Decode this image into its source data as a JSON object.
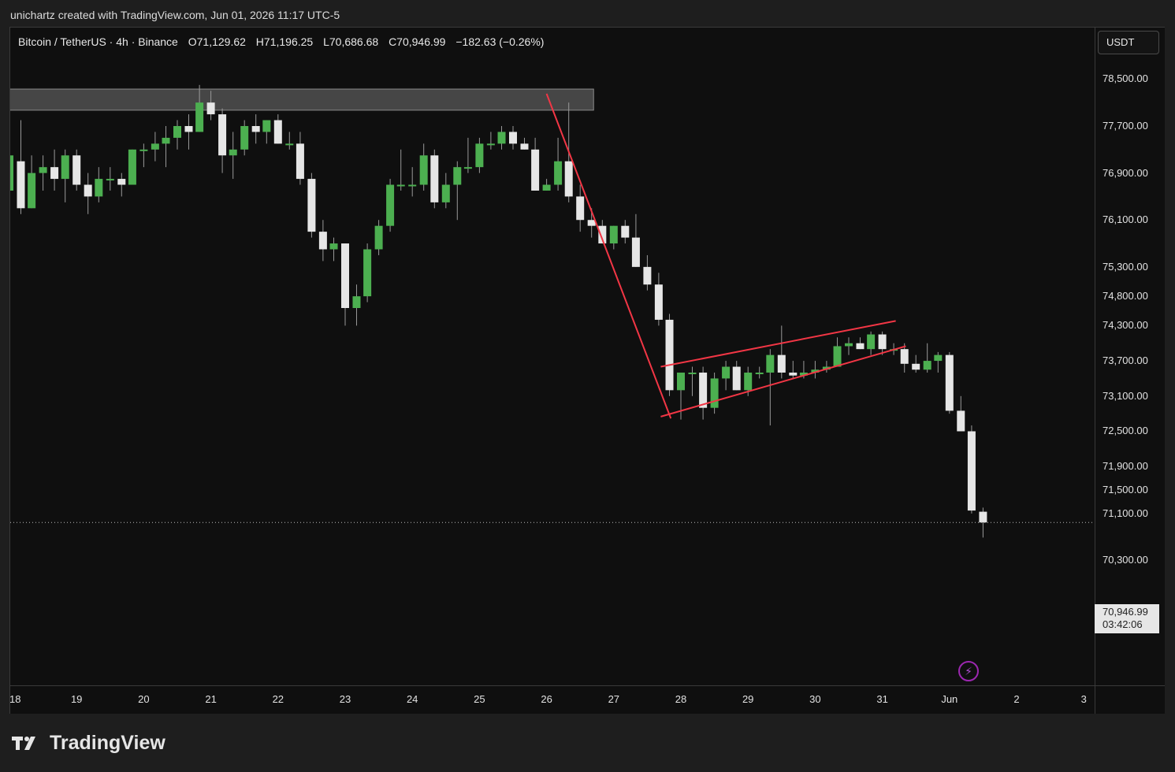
{
  "header": {
    "caption": "unichartz created with TradingView.com, Jun 01, 2026 11:17 UTC-5"
  },
  "legend": {
    "symbol": "Bitcoin / TetherUS · 4h · Binance",
    "open": "O71,129.62",
    "high": "H71,196.25",
    "low": "L70,686.68",
    "close": "C70,946.99",
    "change": "−182.63 (−0.26%)"
  },
  "currency_button": "USDT",
  "last_price": {
    "value": "70,946.99",
    "countdown": "03:42:06"
  },
  "brand": {
    "name": "TradingView"
  },
  "colors": {
    "bull": "#4caf50",
    "bear": "#e6e6e6",
    "background": "#0f0f0f",
    "annotation": "#f23645",
    "zone": "#5a5a5a"
  },
  "chart_data": {
    "type": "candlestick",
    "timeframe": "4h",
    "y_tick_labels": [
      "78,500.00",
      "77,700.00",
      "76,900.00",
      "76,100.00",
      "75,300.00",
      "74,800.00",
      "74,300.00",
      "73,700.00",
      "73,100.00",
      "72,500.00",
      "71,900.00",
      "71,500.00",
      "71,100.00",
      "70,300.00"
    ],
    "x_tick_labels": [
      "18",
      "19",
      "20",
      "21",
      "22",
      "23",
      "24",
      "25",
      "26",
      "27",
      "28",
      "29",
      "30",
      "31",
      "Jun",
      "2",
      "3"
    ],
    "y_range": [
      70000,
      78900
    ],
    "x_range_days": [
      18,
      34
    ],
    "candles": [
      {
        "t": 18.0,
        "o": 76600,
        "h": 77500,
        "l": 76100,
        "c": 77200
      },
      {
        "t": 18.17,
        "o": 77100,
        "h": 77800,
        "l": 76200,
        "c": 76300
      },
      {
        "t": 18.33,
        "o": 76300,
        "h": 77200,
        "l": 76300,
        "c": 76900
      },
      {
        "t": 18.5,
        "o": 76900,
        "h": 77200,
        "l": 76600,
        "c": 77000
      },
      {
        "t": 18.67,
        "o": 77000,
        "h": 77300,
        "l": 76600,
        "c": 76800
      },
      {
        "t": 18.83,
        "o": 76800,
        "h": 77300,
        "l": 76400,
        "c": 77200
      },
      {
        "t": 19.0,
        "o": 77200,
        "h": 77300,
        "l": 76600,
        "c": 76700
      },
      {
        "t": 19.17,
        "o": 76700,
        "h": 76900,
        "l": 76200,
        "c": 76500
      },
      {
        "t": 19.33,
        "o": 76500,
        "h": 77000,
        "l": 76400,
        "c": 76800
      },
      {
        "t": 19.5,
        "o": 76800,
        "h": 77000,
        "l": 76600,
        "c": 76800
      },
      {
        "t": 19.67,
        "o": 76800,
        "h": 76900,
        "l": 76500,
        "c": 76700
      },
      {
        "t": 19.83,
        "o": 76700,
        "h": 77300,
        "l": 76700,
        "c": 77300
      },
      {
        "t": 20.0,
        "o": 77300,
        "h": 77400,
        "l": 77000,
        "c": 77300
      },
      {
        "t": 20.17,
        "o": 77300,
        "h": 77600,
        "l": 77100,
        "c": 77400
      },
      {
        "t": 20.33,
        "o": 77400,
        "h": 77700,
        "l": 77000,
        "c": 77500
      },
      {
        "t": 20.5,
        "o": 77500,
        "h": 77800,
        "l": 77300,
        "c": 77700
      },
      {
        "t": 20.67,
        "o": 77700,
        "h": 77900,
        "l": 77300,
        "c": 77600
      },
      {
        "t": 20.83,
        "o": 77600,
        "h": 78400,
        "l": 77600,
        "c": 78100
      },
      {
        "t": 21.0,
        "o": 78100,
        "h": 78300,
        "l": 77800,
        "c": 77900
      },
      {
        "t": 21.17,
        "o": 77900,
        "h": 78000,
        "l": 76900,
        "c": 77200
      },
      {
        "t": 21.33,
        "o": 77200,
        "h": 77600,
        "l": 76800,
        "c": 77300
      },
      {
        "t": 21.5,
        "o": 77300,
        "h": 77800,
        "l": 77200,
        "c": 77700
      },
      {
        "t": 21.67,
        "o": 77700,
        "h": 77900,
        "l": 77400,
        "c": 77600
      },
      {
        "t": 21.83,
        "o": 77600,
        "h": 77800,
        "l": 77400,
        "c": 77800
      },
      {
        "t": 22.0,
        "o": 77800,
        "h": 77900,
        "l": 77400,
        "c": 77400
      },
      {
        "t": 22.17,
        "o": 77400,
        "h": 77600,
        "l": 77300,
        "c": 77400
      },
      {
        "t": 22.33,
        "o": 77400,
        "h": 77600,
        "l": 76700,
        "c": 76800
      },
      {
        "t": 22.5,
        "o": 76800,
        "h": 76900,
        "l": 75800,
        "c": 75900
      },
      {
        "t": 22.67,
        "o": 75900,
        "h": 76100,
        "l": 75400,
        "c": 75600
      },
      {
        "t": 22.83,
        "o": 75600,
        "h": 75800,
        "l": 75400,
        "c": 75700
      },
      {
        "t": 23.0,
        "o": 75700,
        "h": 75700,
        "l": 74300,
        "c": 74600
      },
      {
        "t": 23.17,
        "o": 74600,
        "h": 75000,
        "l": 74300,
        "c": 74800
      },
      {
        "t": 23.33,
        "o": 74800,
        "h": 75700,
        "l": 74700,
        "c": 75600
      },
      {
        "t": 23.5,
        "o": 75600,
        "h": 76100,
        "l": 75500,
        "c": 76000
      },
      {
        "t": 23.67,
        "o": 76000,
        "h": 76800,
        "l": 75900,
        "c": 76700
      },
      {
        "t": 23.83,
        "o": 76700,
        "h": 77300,
        "l": 76600,
        "c": 76700
      },
      {
        "t": 24.0,
        "o": 76700,
        "h": 77000,
        "l": 76500,
        "c": 76700
      },
      {
        "t": 24.17,
        "o": 76700,
        "h": 77400,
        "l": 76600,
        "c": 77200
      },
      {
        "t": 24.33,
        "o": 77200,
        "h": 77300,
        "l": 76300,
        "c": 76400
      },
      {
        "t": 24.5,
        "o": 76400,
        "h": 76900,
        "l": 76300,
        "c": 76700
      },
      {
        "t": 24.67,
        "o": 76700,
        "h": 77100,
        "l": 76100,
        "c": 77000
      },
      {
        "t": 24.83,
        "o": 77000,
        "h": 77500,
        "l": 76900,
        "c": 77000
      },
      {
        "t": 25.0,
        "o": 77000,
        "h": 77500,
        "l": 76900,
        "c": 77400
      },
      {
        "t": 25.17,
        "o": 77400,
        "h": 77600,
        "l": 77300,
        "c": 77400
      },
      {
        "t": 25.33,
        "o": 77400,
        "h": 77700,
        "l": 77300,
        "c": 77600
      },
      {
        "t": 25.5,
        "o": 77600,
        "h": 77700,
        "l": 77300,
        "c": 77400
      },
      {
        "t": 25.67,
        "o": 77400,
        "h": 77500,
        "l": 77300,
        "c": 77300
      },
      {
        "t": 25.83,
        "o": 77300,
        "h": 77500,
        "l": 76600,
        "c": 76600
      },
      {
        "t": 26.0,
        "o": 76600,
        "h": 76800,
        "l": 76600,
        "c": 76700
      },
      {
        "t": 26.17,
        "o": 76700,
        "h": 77500,
        "l": 76600,
        "c": 77100
      },
      {
        "t": 26.33,
        "o": 77100,
        "h": 78100,
        "l": 76400,
        "c": 76500
      },
      {
        "t": 26.5,
        "o": 76500,
        "h": 76700,
        "l": 75900,
        "c": 76100
      },
      {
        "t": 26.67,
        "o": 76100,
        "h": 76300,
        "l": 75800,
        "c": 76000
      },
      {
        "t": 26.83,
        "o": 76000,
        "h": 76100,
        "l": 75700,
        "c": 75700
      },
      {
        "t": 27.0,
        "o": 75700,
        "h": 76000,
        "l": 75600,
        "c": 76000
      },
      {
        "t": 27.17,
        "o": 76000,
        "h": 76100,
        "l": 75700,
        "c": 75800
      },
      {
        "t": 27.33,
        "o": 75800,
        "h": 76200,
        "l": 75300,
        "c": 75300
      },
      {
        "t": 27.5,
        "o": 75300,
        "h": 75500,
        "l": 74900,
        "c": 75000
      },
      {
        "t": 27.67,
        "o": 75000,
        "h": 75200,
        "l": 74300,
        "c": 74400
      },
      {
        "t": 27.83,
        "o": 74400,
        "h": 74500,
        "l": 73100,
        "c": 73200
      },
      {
        "t": 28.0,
        "o": 73200,
        "h": 73500,
        "l": 72700,
        "c": 73500
      },
      {
        "t": 28.17,
        "o": 73500,
        "h": 73600,
        "l": 73100,
        "c": 73500
      },
      {
        "t": 28.33,
        "o": 73500,
        "h": 73600,
        "l": 72700,
        "c": 72900
      },
      {
        "t": 28.5,
        "o": 72900,
        "h": 73500,
        "l": 72800,
        "c": 73400
      },
      {
        "t": 28.67,
        "o": 73400,
        "h": 73700,
        "l": 73200,
        "c": 73600
      },
      {
        "t": 28.83,
        "o": 73600,
        "h": 73700,
        "l": 73200,
        "c": 73200
      },
      {
        "t": 29.0,
        "o": 73200,
        "h": 73600,
        "l": 73100,
        "c": 73500
      },
      {
        "t": 29.17,
        "o": 73500,
        "h": 73600,
        "l": 73400,
        "c": 73500
      },
      {
        "t": 29.33,
        "o": 73500,
        "h": 73900,
        "l": 72600,
        "c": 73800
      },
      {
        "t": 29.5,
        "o": 73800,
        "h": 74300,
        "l": 73400,
        "c": 73500
      },
      {
        "t": 29.67,
        "o": 73500,
        "h": 73700,
        "l": 73400,
        "c": 73450
      },
      {
        "t": 29.83,
        "o": 73450,
        "h": 73700,
        "l": 73400,
        "c": 73500
      },
      {
        "t": 30.0,
        "o": 73500,
        "h": 73700,
        "l": 73400,
        "c": 73550
      },
      {
        "t": 30.17,
        "o": 73550,
        "h": 73700,
        "l": 73500,
        "c": 73600
      },
      {
        "t": 30.33,
        "o": 73600,
        "h": 74100,
        "l": 73600,
        "c": 73950
      },
      {
        "t": 30.5,
        "o": 73950,
        "h": 74100,
        "l": 73800,
        "c": 74000
      },
      {
        "t": 30.67,
        "o": 74000,
        "h": 74100,
        "l": 73900,
        "c": 73900
      },
      {
        "t": 30.83,
        "o": 73900,
        "h": 74200,
        "l": 73800,
        "c": 74150
      },
      {
        "t": 31.0,
        "o": 74150,
        "h": 74200,
        "l": 73800,
        "c": 73900
      },
      {
        "t": 31.17,
        "o": 73900,
        "h": 74000,
        "l": 73800,
        "c": 73900
      },
      {
        "t": 31.33,
        "o": 73900,
        "h": 74000,
        "l": 73500,
        "c": 73650
      },
      {
        "t": 31.5,
        "o": 73650,
        "h": 73800,
        "l": 73500,
        "c": 73550
      },
      {
        "t": 31.67,
        "o": 73550,
        "h": 74000,
        "l": 73500,
        "c": 73700
      },
      {
        "t": 31.83,
        "o": 73700,
        "h": 73850,
        "l": 73500,
        "c": 73800
      },
      {
        "t": 32.0,
        "o": 73800,
        "h": 73850,
        "l": 72800,
        "c": 72850
      },
      {
        "t": 32.17,
        "o": 72850,
        "h": 73100,
        "l": 72500,
        "c": 72500
      },
      {
        "t": 32.33,
        "o": 72500,
        "h": 72600,
        "l": 71100,
        "c": 71150
      },
      {
        "t": 32.5,
        "o": 71130,
        "h": 71200,
        "l": 70690,
        "c": 70947
      }
    ],
    "annotations": {
      "resistance_zone": {
        "x_start": 18.0,
        "x_end": 26.7,
        "y_low": 77970,
        "y_high": 78330
      },
      "trend_line": {
        "x1": 26.0,
        "y1": 78250,
        "x2": 27.85,
        "y2": 72720
      },
      "channel_upper": {
        "x1": 27.7,
        "y1": 73600,
        "x2": 31.2,
        "y2": 74380
      },
      "channel_lower": {
        "x1": 27.7,
        "y1": 72750,
        "x2": 31.35,
        "y2": 73950
      }
    }
  }
}
